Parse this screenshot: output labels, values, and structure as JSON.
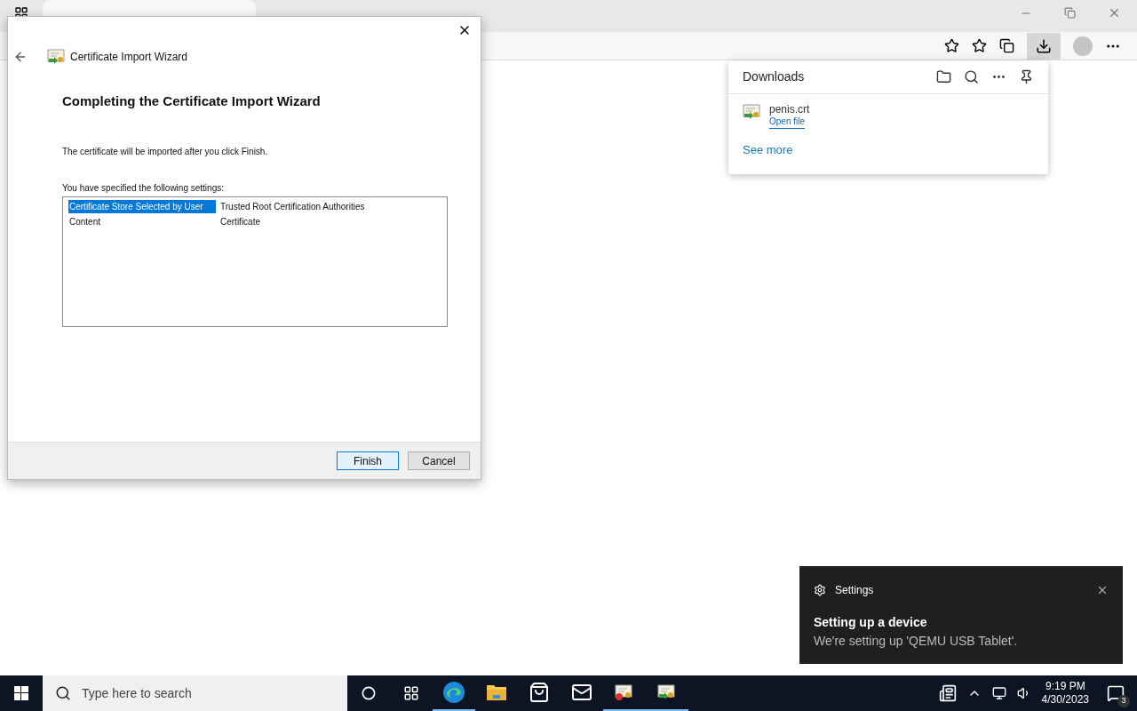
{
  "browser": {
    "downloads_open": true
  },
  "downloads": {
    "title": "Downloads",
    "items": [
      {
        "name": "penis.crt",
        "action": "Open file"
      }
    ],
    "see_more": "See more"
  },
  "dialog": {
    "title": "Certificate Import Wizard",
    "heading": "Completing the Certificate Import Wizard",
    "message": "The certificate will be imported after you click Finish.",
    "settings_label": "You have specified the following settings:",
    "settings": [
      {
        "name": "Certificate Store Selected by User",
        "value": "Trusted Root Certification Authorities",
        "selected": true
      },
      {
        "name": "Content",
        "value": "Certificate",
        "selected": false
      }
    ],
    "buttons": [
      {
        "label": "Finish",
        "focused": true
      },
      {
        "label": "Cancel",
        "focused": false
      }
    ]
  },
  "toast": {
    "app": "Settings",
    "title": "Setting up a device",
    "body": "We're setting up 'QEMU USB Tablet'."
  },
  "taskbar": {
    "search_placeholder": "Type here to search",
    "apps": [
      {
        "kind": "edge",
        "running": true
      },
      {
        "kind": "explorer",
        "running": false
      },
      {
        "kind": "store",
        "running": false
      },
      {
        "kind": "mail",
        "running": false
      },
      {
        "kind": "cert-error",
        "running": true
      },
      {
        "kind": "cert-import",
        "running": true
      }
    ],
    "time": "9:19 PM",
    "date": "4/30/2023",
    "notifications": "3"
  }
}
